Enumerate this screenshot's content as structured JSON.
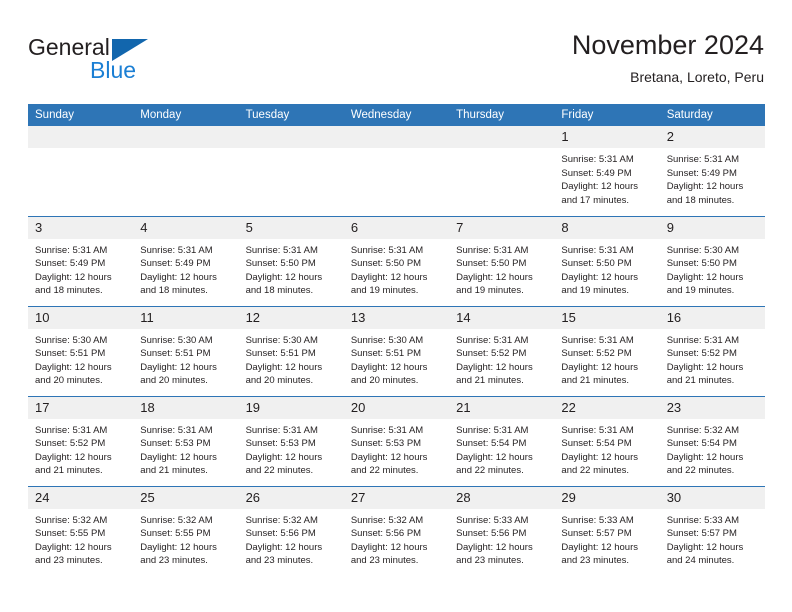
{
  "logo": {
    "word1": "General",
    "word2": "Blue",
    "triangle_color": "#1266ad",
    "word2_color": "#1b7fd4"
  },
  "header": {
    "title": "November 2024",
    "subtitle": "Bretana, Loreto, Peru"
  },
  "theme": {
    "header_blue": "#2e75b6",
    "daynum_gray": "#f0f0f0",
    "text": "#231f20"
  },
  "weekdays": [
    "Sunday",
    "Monday",
    "Tuesday",
    "Wednesday",
    "Thursday",
    "Friday",
    "Saturday"
  ],
  "labels": {
    "sunrise_prefix": "Sunrise: ",
    "sunset_prefix": "Sunset: ",
    "daylight_prefix": "Daylight: "
  },
  "weeks": [
    [
      {
        "day": "",
        "empty": true
      },
      {
        "day": "",
        "empty": true
      },
      {
        "day": "",
        "empty": true
      },
      {
        "day": "",
        "empty": true
      },
      {
        "day": "",
        "empty": true
      },
      {
        "day": "1",
        "sunrise": "Sunrise: 5:31 AM",
        "sunset": "Sunset: 5:49 PM",
        "daylight": "Daylight: 12 hours and 17 minutes."
      },
      {
        "day": "2",
        "sunrise": "Sunrise: 5:31 AM",
        "sunset": "Sunset: 5:49 PM",
        "daylight": "Daylight: 12 hours and 18 minutes."
      }
    ],
    [
      {
        "day": "3",
        "sunrise": "Sunrise: 5:31 AM",
        "sunset": "Sunset: 5:49 PM",
        "daylight": "Daylight: 12 hours and 18 minutes."
      },
      {
        "day": "4",
        "sunrise": "Sunrise: 5:31 AM",
        "sunset": "Sunset: 5:49 PM",
        "daylight": "Daylight: 12 hours and 18 minutes."
      },
      {
        "day": "5",
        "sunrise": "Sunrise: 5:31 AM",
        "sunset": "Sunset: 5:50 PM",
        "daylight": "Daylight: 12 hours and 18 minutes."
      },
      {
        "day": "6",
        "sunrise": "Sunrise: 5:31 AM",
        "sunset": "Sunset: 5:50 PM",
        "daylight": "Daylight: 12 hours and 19 minutes."
      },
      {
        "day": "7",
        "sunrise": "Sunrise: 5:31 AM",
        "sunset": "Sunset: 5:50 PM",
        "daylight": "Daylight: 12 hours and 19 minutes."
      },
      {
        "day": "8",
        "sunrise": "Sunrise: 5:31 AM",
        "sunset": "Sunset: 5:50 PM",
        "daylight": "Daylight: 12 hours and 19 minutes."
      },
      {
        "day": "9",
        "sunrise": "Sunrise: 5:30 AM",
        "sunset": "Sunset: 5:50 PM",
        "daylight": "Daylight: 12 hours and 19 minutes."
      }
    ],
    [
      {
        "day": "10",
        "sunrise": "Sunrise: 5:30 AM",
        "sunset": "Sunset: 5:51 PM",
        "daylight": "Daylight: 12 hours and 20 minutes."
      },
      {
        "day": "11",
        "sunrise": "Sunrise: 5:30 AM",
        "sunset": "Sunset: 5:51 PM",
        "daylight": "Daylight: 12 hours and 20 minutes."
      },
      {
        "day": "12",
        "sunrise": "Sunrise: 5:30 AM",
        "sunset": "Sunset: 5:51 PM",
        "daylight": "Daylight: 12 hours and 20 minutes."
      },
      {
        "day": "13",
        "sunrise": "Sunrise: 5:30 AM",
        "sunset": "Sunset: 5:51 PM",
        "daylight": "Daylight: 12 hours and 20 minutes."
      },
      {
        "day": "14",
        "sunrise": "Sunrise: 5:31 AM",
        "sunset": "Sunset: 5:52 PM",
        "daylight": "Daylight: 12 hours and 21 minutes."
      },
      {
        "day": "15",
        "sunrise": "Sunrise: 5:31 AM",
        "sunset": "Sunset: 5:52 PM",
        "daylight": "Daylight: 12 hours and 21 minutes."
      },
      {
        "day": "16",
        "sunrise": "Sunrise: 5:31 AM",
        "sunset": "Sunset: 5:52 PM",
        "daylight": "Daylight: 12 hours and 21 minutes."
      }
    ],
    [
      {
        "day": "17",
        "sunrise": "Sunrise: 5:31 AM",
        "sunset": "Sunset: 5:52 PM",
        "daylight": "Daylight: 12 hours and 21 minutes."
      },
      {
        "day": "18",
        "sunrise": "Sunrise: 5:31 AM",
        "sunset": "Sunset: 5:53 PM",
        "daylight": "Daylight: 12 hours and 21 minutes."
      },
      {
        "day": "19",
        "sunrise": "Sunrise: 5:31 AM",
        "sunset": "Sunset: 5:53 PM",
        "daylight": "Daylight: 12 hours and 22 minutes."
      },
      {
        "day": "20",
        "sunrise": "Sunrise: 5:31 AM",
        "sunset": "Sunset: 5:53 PM",
        "daylight": "Daylight: 12 hours and 22 minutes."
      },
      {
        "day": "21",
        "sunrise": "Sunrise: 5:31 AM",
        "sunset": "Sunset: 5:54 PM",
        "daylight": "Daylight: 12 hours and 22 minutes."
      },
      {
        "day": "22",
        "sunrise": "Sunrise: 5:31 AM",
        "sunset": "Sunset: 5:54 PM",
        "daylight": "Daylight: 12 hours and 22 minutes."
      },
      {
        "day": "23",
        "sunrise": "Sunrise: 5:32 AM",
        "sunset": "Sunset: 5:54 PM",
        "daylight": "Daylight: 12 hours and 22 minutes."
      }
    ],
    [
      {
        "day": "24",
        "sunrise": "Sunrise: 5:32 AM",
        "sunset": "Sunset: 5:55 PM",
        "daylight": "Daylight: 12 hours and 23 minutes."
      },
      {
        "day": "25",
        "sunrise": "Sunrise: 5:32 AM",
        "sunset": "Sunset: 5:55 PM",
        "daylight": "Daylight: 12 hours and 23 minutes."
      },
      {
        "day": "26",
        "sunrise": "Sunrise: 5:32 AM",
        "sunset": "Sunset: 5:56 PM",
        "daylight": "Daylight: 12 hours and 23 minutes."
      },
      {
        "day": "27",
        "sunrise": "Sunrise: 5:32 AM",
        "sunset": "Sunset: 5:56 PM",
        "daylight": "Daylight: 12 hours and 23 minutes."
      },
      {
        "day": "28",
        "sunrise": "Sunrise: 5:33 AM",
        "sunset": "Sunset: 5:56 PM",
        "daylight": "Daylight: 12 hours and 23 minutes."
      },
      {
        "day": "29",
        "sunrise": "Sunrise: 5:33 AM",
        "sunset": "Sunset: 5:57 PM",
        "daylight": "Daylight: 12 hours and 23 minutes."
      },
      {
        "day": "30",
        "sunrise": "Sunrise: 5:33 AM",
        "sunset": "Sunset: 5:57 PM",
        "daylight": "Daylight: 12 hours and 24 minutes."
      }
    ]
  ]
}
